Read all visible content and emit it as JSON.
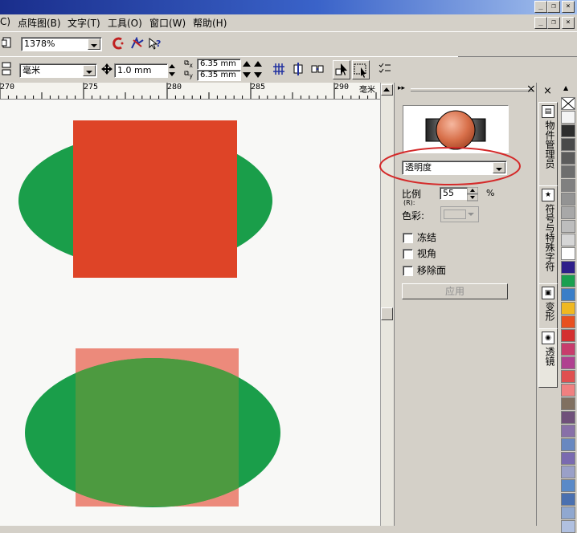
{
  "menubar": {
    "items": [
      "C)",
      "点阵图(B)",
      "文字(T)",
      "工具(O)",
      "窗口(W)",
      "帮助(H)"
    ]
  },
  "window_buttons": {
    "minimize": "_",
    "restore": "❐",
    "close": "×"
  },
  "toolbar1": {
    "zoom_value": "1378%"
  },
  "propertybar": {
    "units_value": "毫米",
    "nudge_value": "1.0 mm",
    "dup_x_label": "x",
    "dup_y_label": "y",
    "dup_x_value": "6.35 mm",
    "dup_y_value": "6.35 mm"
  },
  "ruler": {
    "ticks": [
      "270",
      "275",
      "280",
      "285",
      "290"
    ],
    "unit": "毫米"
  },
  "docker": {
    "lens_type_value": "透明度",
    "rate_label": "比例",
    "rate_sub_label": "(R):",
    "rate_value": "55",
    "rate_unit": "%",
    "color_label": "色彩:",
    "frozen_label": "冻结",
    "viewpoint_label": "视角",
    "remove_face_label": "移除面",
    "apply_label": "应用"
  },
  "side_tabs": [
    "物件管理员",
    "符号与特殊字符",
    "变形",
    "透镜"
  ],
  "colors": {
    "ellipse_green": "#1a9e4a",
    "rect_red": "#de4427",
    "rect_faded": "#ec8a7b",
    "overlap_mix": "#4d9a40",
    "annotation": "#d42a2a"
  },
  "palette": [
    "#f4f4f4",
    "#2e2e2e",
    "#4a4a4a",
    "#5c5c5c",
    "#6e6e6e",
    "#808080",
    "#939393",
    "#a8a8a8",
    "#bdbdbd",
    "#d6d6d6",
    "#ffffff",
    "#2f1f8a",
    "#1aa050",
    "#3a7ec8",
    "#f0b820",
    "#e85020",
    "#d43030",
    "#c83c6c",
    "#b04090",
    "#e05050",
    "#f08080",
    "#807060",
    "#70507a",
    "#8870a8",
    "#6888c0",
    "#7a6ab0",
    "#9aa0c8",
    "#5a8ac8",
    "#4a70b0",
    "#90a8d0",
    "#b0c0e0"
  ]
}
